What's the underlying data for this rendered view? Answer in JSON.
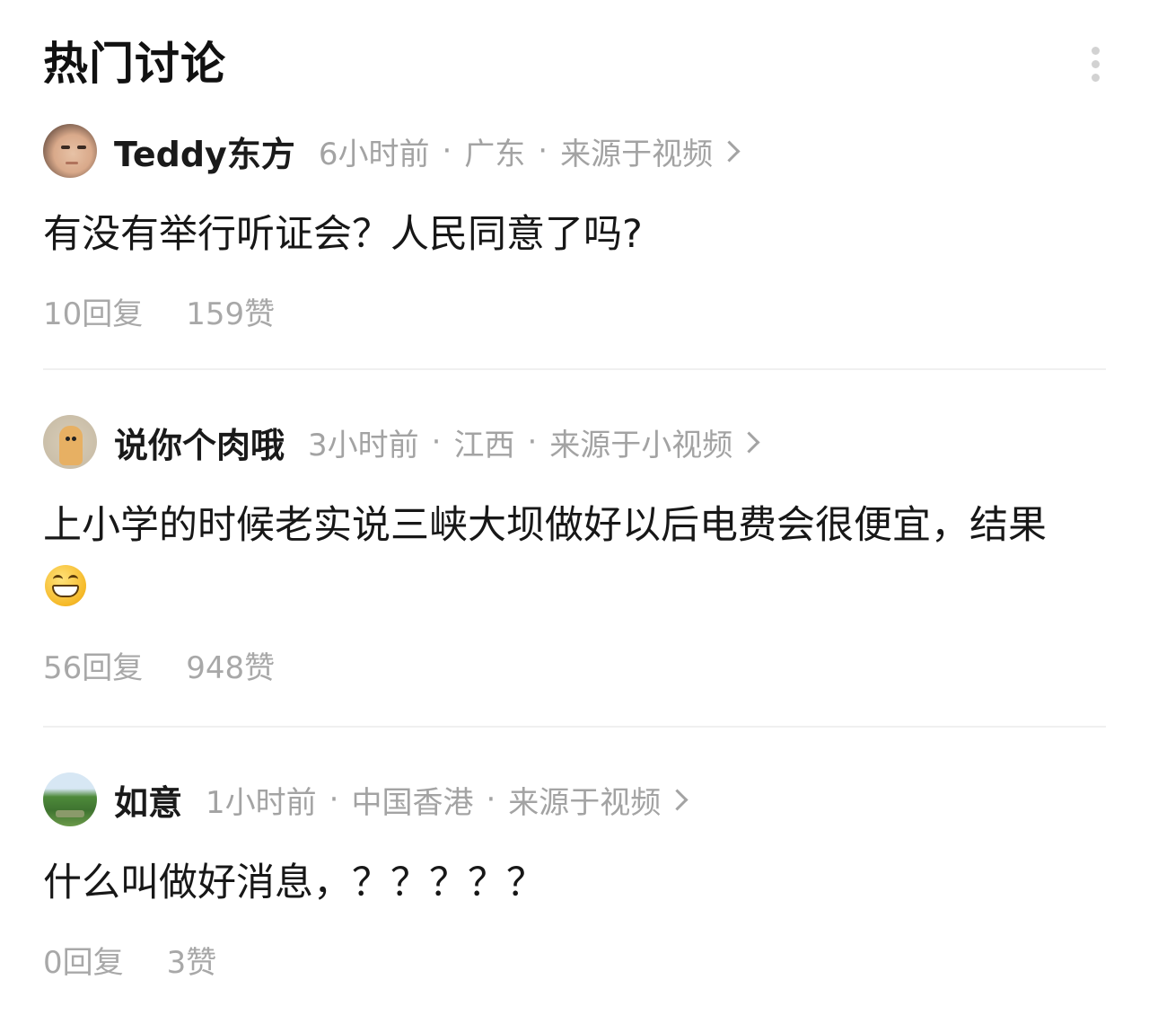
{
  "header": {
    "title": "热门讨论",
    "more_icon": "more-vertical-icon"
  },
  "comments": [
    {
      "avatar_icon": "user-avatar-photo",
      "username": "Teddy东方",
      "time": "6小时前",
      "location": "广东",
      "source": "来源于视频",
      "text": "有没有举行听证会？人民同意了吗?",
      "emoji": "",
      "replies": "10回复",
      "likes": "159赞"
    },
    {
      "avatar_icon": "user-avatar-toy",
      "username": "说你个肉哦",
      "time": "3小时前",
      "location": "江西",
      "source": "来源于小视频",
      "text": "上小学的时候老实说三峡大坝做好以后电费会很便宜，结果",
      "emoji": "grinning-face-emoji",
      "replies": "56回复",
      "likes": "948赞"
    },
    {
      "avatar_icon": "user-avatar-tree",
      "username": "如意",
      "time": "1小时前",
      "location": "中国香港",
      "source": "来源于视频",
      "text": "什么叫做好消息，？？？？？",
      "emoji": "",
      "replies": "0回复",
      "likes": "3赞"
    }
  ],
  "separator": "·"
}
